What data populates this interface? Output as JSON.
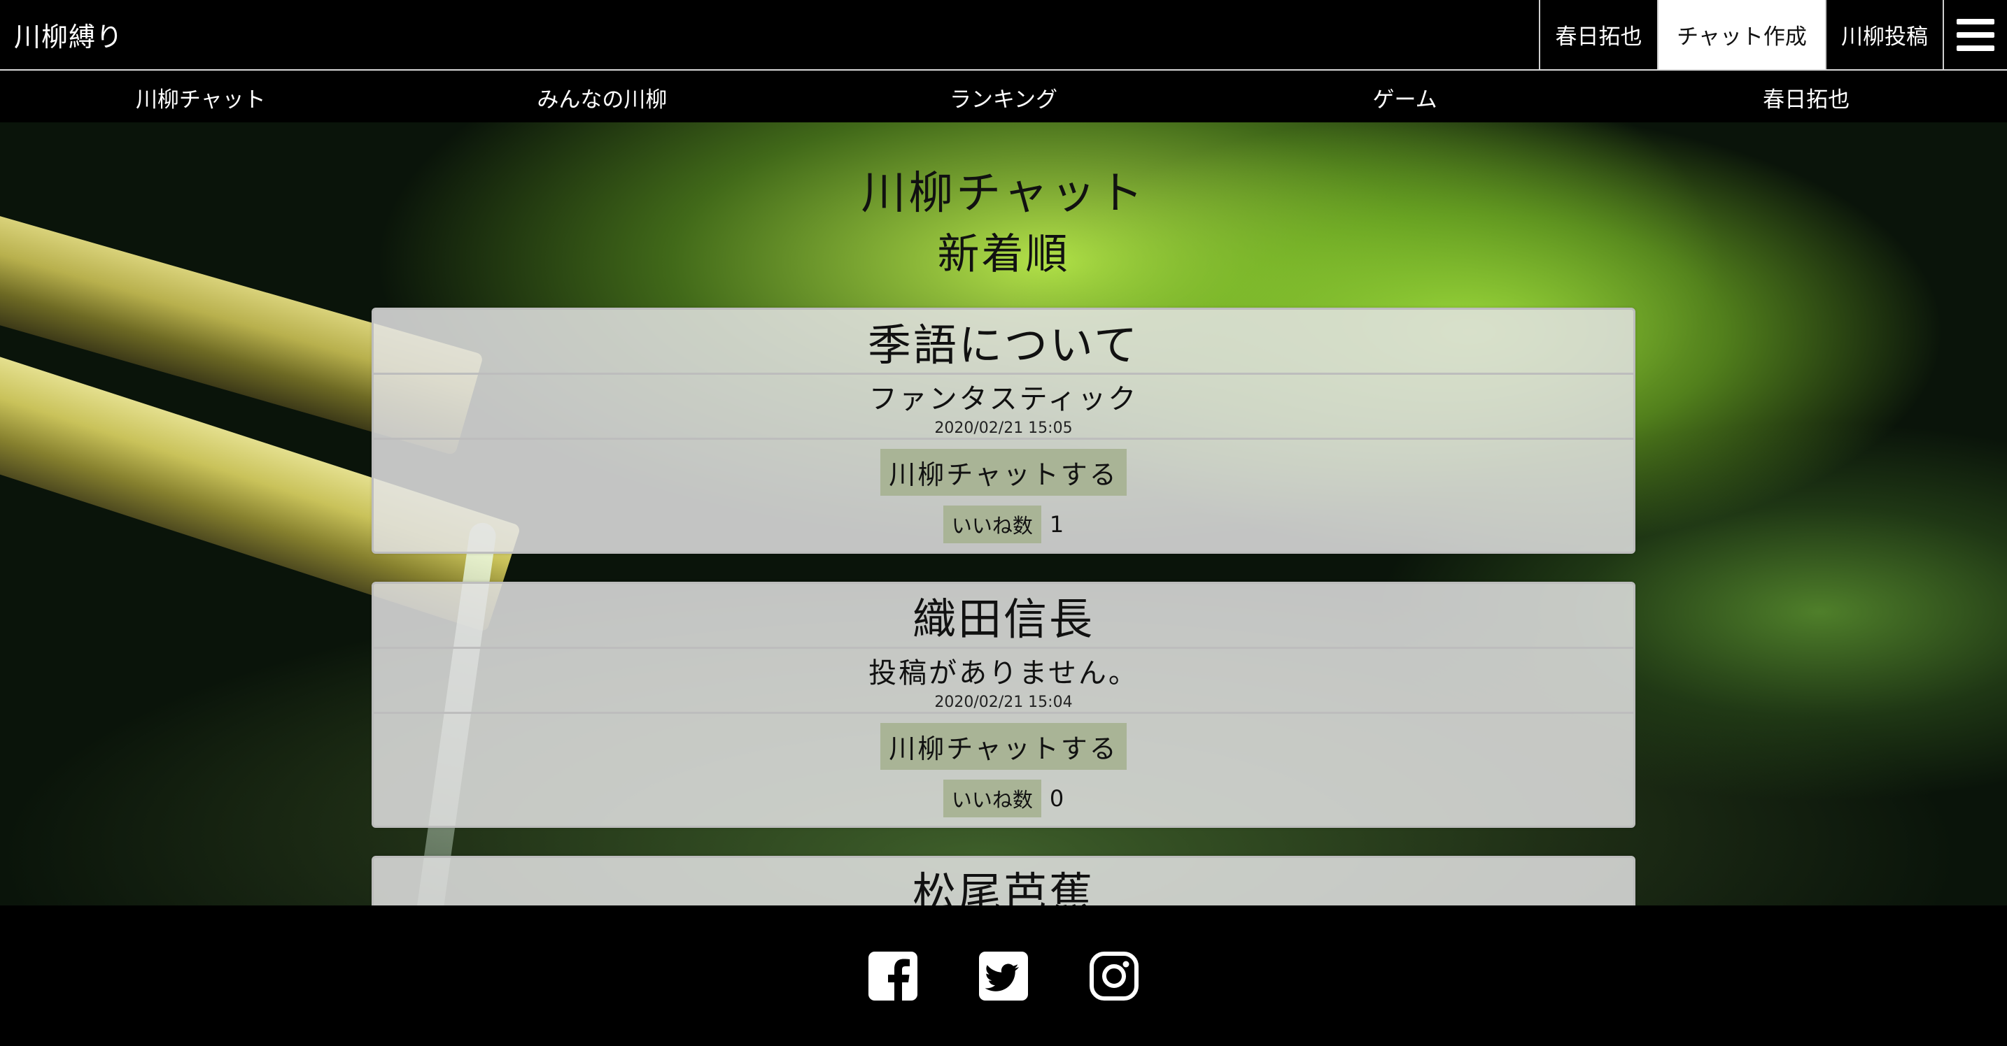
{
  "header": {
    "brand": "川柳縛り",
    "user_label": "春日拓也",
    "create_chat_label": "チャット作成",
    "post_label": "川柳投稿"
  },
  "nav": {
    "items": [
      {
        "label": "川柳チャット"
      },
      {
        "label": "みんなの川柳"
      },
      {
        "label": "ランキング"
      },
      {
        "label": "ゲーム"
      },
      {
        "label": "春日拓也"
      }
    ]
  },
  "main": {
    "title": "川柳チャット",
    "sort_label": "新着順",
    "chats": [
      {
        "title": "季語について",
        "latest": "ファンタスティック",
        "date": "2020/02/21 15:05",
        "chat_button": "川柳チャットする",
        "likes_label": "いいね数",
        "likes": "1"
      },
      {
        "title": "織田信長",
        "latest": "投稿がありません。",
        "date": "2020/02/21 15:04",
        "chat_button": "川柳チャットする",
        "likes_label": "いいね数",
        "likes": "0"
      },
      {
        "title": "松尾芭蕉"
      }
    ]
  },
  "footer": {
    "icons": [
      "facebook-icon",
      "twitter-icon",
      "instagram-icon"
    ]
  },
  "colors": {
    "header_bg": "#000000",
    "card_bg": "#e2e2e2",
    "button_bg": "#a9b496"
  }
}
